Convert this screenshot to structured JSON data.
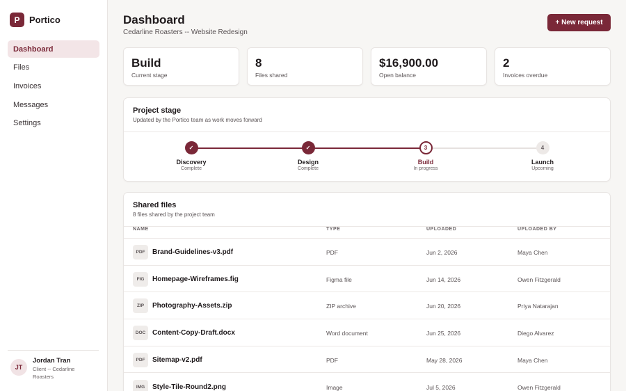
{
  "brand": {
    "logo_letter": "P",
    "name": "Portico",
    "accent": "#7a2838"
  },
  "nav": [
    {
      "label": "Dashboard",
      "active": true
    },
    {
      "label": "Files"
    },
    {
      "label": "Invoices"
    },
    {
      "label": "Messages"
    },
    {
      "label": "Settings"
    }
  ],
  "user": {
    "initials": "JT",
    "name": "Jordan Tran",
    "role": "Client -- Cedarline Roasters"
  },
  "header": {
    "title": "Dashboard",
    "subtitle": "Cedarline Roasters -- Website Redesign",
    "new_request_label": "+ New request"
  },
  "stats": [
    {
      "value": "Build",
      "label": "Current stage"
    },
    {
      "value": "8",
      "label": "Files shared"
    },
    {
      "value": "$16,900.00",
      "label": "Open balance"
    },
    {
      "value": "2",
      "label": "Invoices overdue"
    }
  ],
  "project_stage": {
    "title": "Project stage",
    "subtitle": "Updated by the Portico team as work moves forward",
    "steps": [
      {
        "marker": "✓",
        "name": "Discovery",
        "status": "Complete",
        "state": "done"
      },
      {
        "marker": "✓",
        "name": "Design",
        "status": "Complete",
        "state": "done"
      },
      {
        "marker": "3",
        "name": "Build",
        "status": "In progress",
        "state": "current"
      },
      {
        "marker": "4",
        "name": "Launch",
        "status": "Upcoming",
        "state": "upcoming"
      }
    ]
  },
  "shared_files": {
    "title": "Shared files",
    "subtitle": "8 files shared by the project team",
    "columns": {
      "name": "NAME",
      "type": "TYPE",
      "uploaded": "UPLOADED",
      "uploaded_by": "UPLOADED BY"
    },
    "rows": [
      {
        "badge": "PDF",
        "name": "Brand-Guidelines-v3.pdf",
        "type": "PDF",
        "uploaded": "Jun 2, 2026",
        "by": "Maya Chen"
      },
      {
        "badge": "FIG",
        "name": "Homepage-Wireframes.fig",
        "type": "Figma file",
        "uploaded": "Jun 14, 2026",
        "by": "Owen Fitzgerald"
      },
      {
        "badge": "ZIP",
        "name": "Photography-Assets.zip",
        "type": "ZIP archive",
        "uploaded": "Jun 20, 2026",
        "by": "Priya Natarajan"
      },
      {
        "badge": "DOC",
        "name": "Content-Copy-Draft.docx",
        "type": "Word document",
        "uploaded": "Jun 25, 2026",
        "by": "Diego Alvarez"
      },
      {
        "badge": "PDF",
        "name": "Sitemap-v2.pdf",
        "type": "PDF",
        "uploaded": "May 28, 2026",
        "by": "Maya Chen"
      },
      {
        "badge": "IMG",
        "name": "Style-Tile-Round2.png",
        "type": "Image",
        "uploaded": "Jul 5, 2026",
        "by": "Owen Fitzgerald"
      }
    ]
  }
}
